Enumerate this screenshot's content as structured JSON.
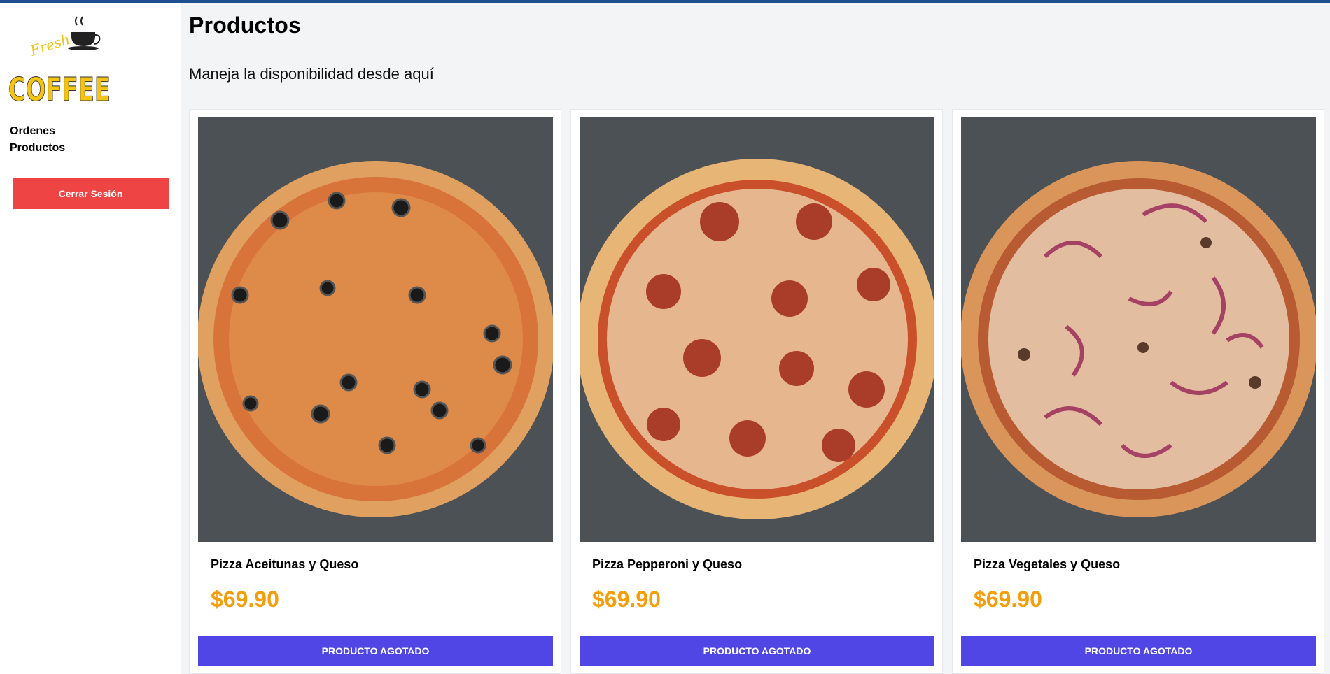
{
  "sidebar": {
    "logo": {
      "script_text": "Fresh",
      "word_text": "COFFEE"
    },
    "nav": [
      {
        "label": "Ordenes"
      },
      {
        "label": "Productos"
      }
    ],
    "logout_label": "Cerrar Sesión"
  },
  "main": {
    "title": "Productos",
    "subtitle": "Maneja la disponibilidad desde aquí",
    "products": [
      {
        "name": "Pizza Aceitunas y Queso",
        "price": "$69.90",
        "button_label": "PRODUCTO AGOTADO",
        "image": "pizza-olives-photo"
      },
      {
        "name": "Pizza Pepperoni y Queso",
        "price": "$69.90",
        "button_label": "PRODUCTO AGOTADO",
        "image": "pizza-pepperoni-photo"
      },
      {
        "name": "Pizza Vegetales y Queso",
        "price": "$69.90",
        "button_label": "PRODUCTO AGOTADO",
        "image": "pizza-vegetables-photo"
      }
    ]
  },
  "colors": {
    "top_border": "#1e4f91",
    "logout_button": "#ef4444",
    "action_button": "#4f46e5",
    "price": "#f59e0b",
    "logo_yellow": "#f4c415"
  }
}
